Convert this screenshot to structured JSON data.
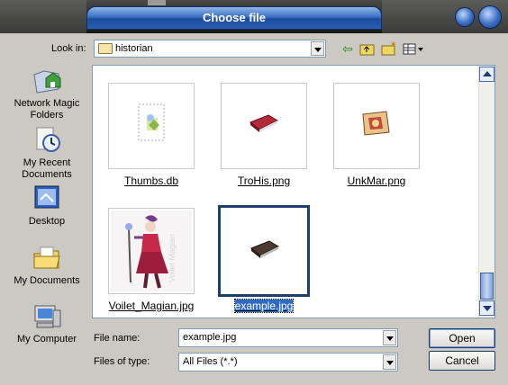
{
  "window": {
    "title": "Choose file"
  },
  "lookin": {
    "label": "Look in:",
    "value": "historian"
  },
  "places": [
    {
      "label": "Network Magic Folders",
      "icon": "network-folder-icon"
    },
    {
      "label": "My Recent Documents",
      "icon": "recent-documents-icon"
    },
    {
      "label": "Desktop",
      "icon": "desktop-icon"
    },
    {
      "label": "My Documents",
      "icon": "my-documents-icon"
    },
    {
      "label": "My Computer",
      "icon": "my-computer-icon"
    }
  ],
  "files": [
    {
      "name": "Thumbs.db",
      "icon": "thumbs-db-icon"
    },
    {
      "name": "TroHis.png",
      "icon": "book-thumbnail"
    },
    {
      "name": "UnkMar.png",
      "icon": "map-thumbnail"
    },
    {
      "name": "Voilet_Magian.jpg",
      "icon": "character-thumbnail",
      "watermark": "Voilet Magian"
    },
    {
      "name": "example.jpg",
      "icon": "book-thumbnail",
      "selected": true
    }
  ],
  "filename": {
    "label": "File name:",
    "value": "example.jpg"
  },
  "filetype": {
    "label": "Files of type:",
    "value": "All Files (*.*)"
  },
  "buttons": {
    "open": "Open",
    "cancel": "Cancel"
  },
  "colors": {
    "title_blue": "#2b5fb2",
    "selection": "#316ac5",
    "panel": "#ccc9c2"
  }
}
